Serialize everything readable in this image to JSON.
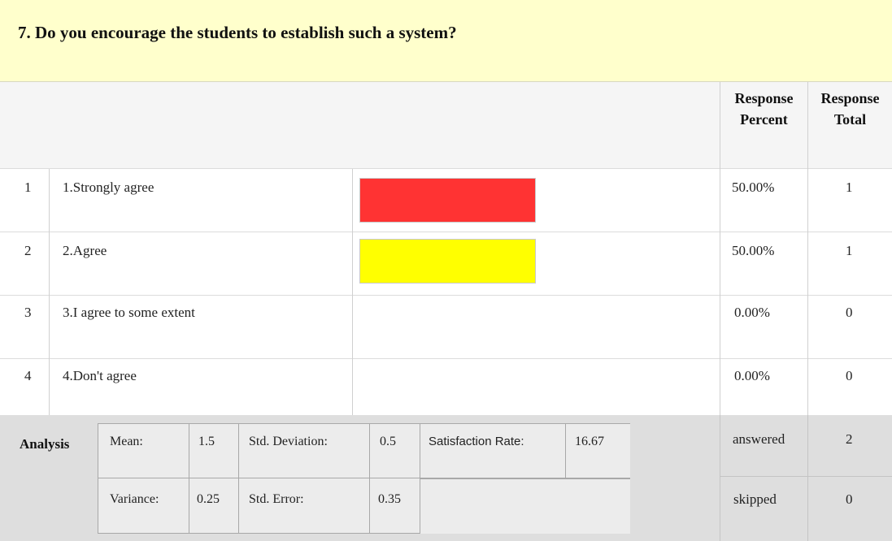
{
  "question": {
    "title": "7. Do you encourage the students to establish such a system?"
  },
  "headers": {
    "percent_l1": "Response",
    "percent_l2": "Percent",
    "total_l1": "Response",
    "total_l2": "Total"
  },
  "rows": [
    {
      "num": "1",
      "label": "1.Strongly agree",
      "percent": "50.00%",
      "total": "1",
      "share": 0.5,
      "color": "#ff3333"
    },
    {
      "num": "2",
      "label": "2.Agree",
      "percent": "50.00%",
      "total": "1",
      "share": 0.5,
      "color": "#ffff00"
    },
    {
      "num": "3",
      "label": "3.I agree to some extent",
      "percent": "0.00%",
      "total": "0",
      "share": 0,
      "color": ""
    },
    {
      "num": "4",
      "label": "4.Don't agree",
      "percent": "0.00%",
      "total": "0",
      "share": 0,
      "color": ""
    }
  ],
  "analysis": {
    "label": "Analysis",
    "mean_label": "Mean:",
    "mean": "1.5",
    "std_dev_label": "Std. Deviation:",
    "std_dev": "0.5",
    "satisfaction_label": "Satisfaction Rate:",
    "satisfaction": "16.67",
    "variance_label": "Variance:",
    "variance": "0.25",
    "std_err_label": "Std. Error:",
    "std_err": "0.35"
  },
  "summary": {
    "answered_label": "answered",
    "answered": "2",
    "skipped_label": "skipped",
    "skipped": "0"
  }
}
